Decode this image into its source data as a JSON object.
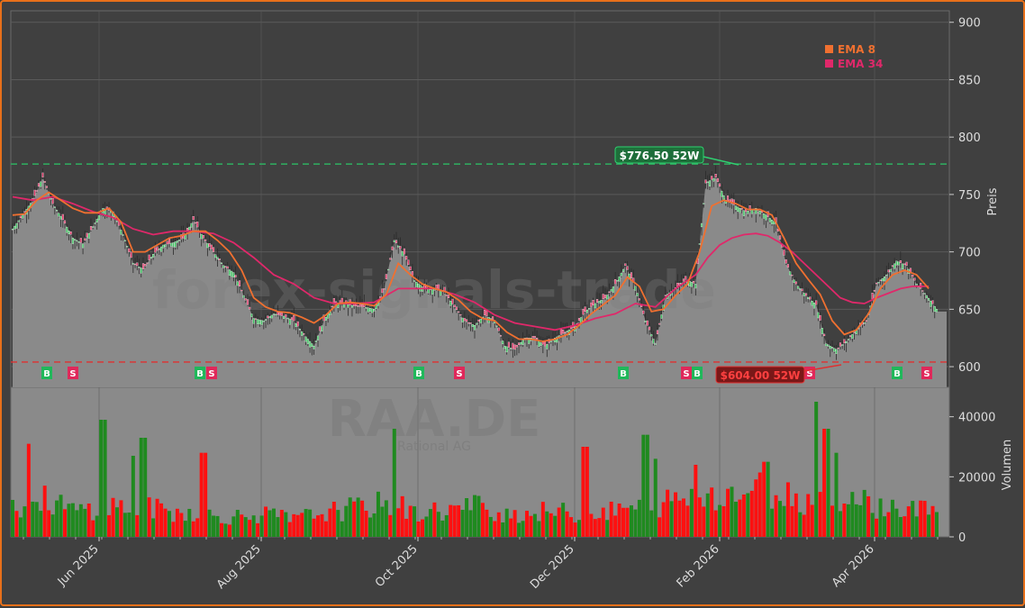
{
  "chart_data": {
    "type": "candlestick",
    "ticker_watermark": "RAA.DE",
    "company_watermark": "Rational AG",
    "site_watermark": "forex-signals-trade",
    "price_axis_label": "Preis",
    "volume_axis_label": "Volumen",
    "price_ticks": [
      600,
      650,
      700,
      750,
      800,
      850,
      900
    ],
    "price_ylim": [
      582,
      910
    ],
    "volume_ticks": [
      0,
      20000,
      40000
    ],
    "volume_ylim": [
      0,
      48000
    ],
    "x_ticks": [
      "Jun 2025",
      "Aug 2025",
      "Oct 2025",
      "Dec 2025",
      "Feb 2026",
      "Apr 2026"
    ],
    "high_52w": {
      "value": 776.5,
      "label": "$776.50 52W"
    },
    "low_52w": {
      "value": 604.0,
      "label": "$604.00 52W"
    },
    "legend": [
      {
        "name": "EMA 8",
        "color": "#f07030"
      },
      {
        "name": "EMA 34",
        "color": "#e0286a"
      }
    ],
    "signals": [
      "B",
      "S",
      "B",
      "S",
      "B",
      "S",
      "B",
      "S",
      "B",
      "S",
      "B",
      "S"
    ],
    "price_series": [
      [
        0,
        720
      ],
      [
        5,
        732
      ],
      [
        10,
        745
      ],
      [
        15,
        765
      ],
      [
        20,
        742
      ],
      [
        25,
        728
      ],
      [
        30,
        712
      ],
      [
        35,
        707
      ],
      [
        40,
        722
      ],
      [
        45,
        738
      ],
      [
        50,
        735
      ],
      [
        55,
        715
      ],
      [
        60,
        690
      ],
      [
        65,
        685
      ],
      [
        70,
        698
      ],
      [
        75,
        706
      ],
      [
        80,
        708
      ],
      [
        85,
        712
      ],
      [
        90,
        728
      ],
      [
        95,
        712
      ],
      [
        100,
        700
      ],
      [
        105,
        688
      ],
      [
        110,
        682
      ],
      [
        115,
        662
      ],
      [
        120,
        642
      ],
      [
        125,
        640
      ],
      [
        130,
        646
      ],
      [
        135,
        644
      ],
      [
        140,
        640
      ],
      [
        145,
        628
      ],
      [
        150,
        618
      ],
      [
        155,
        640
      ],
      [
        160,
        655
      ],
      [
        165,
        655
      ],
      [
        170,
        653
      ],
      [
        175,
        652
      ],
      [
        180,
        650
      ],
      [
        185,
        668
      ],
      [
        190,
        710
      ],
      [
        195,
        698
      ],
      [
        200,
        675
      ],
      [
        205,
        668
      ],
      [
        210,
        668
      ],
      [
        215,
        665
      ],
      [
        220,
        652
      ],
      [
        225,
        640
      ],
      [
        230,
        636
      ],
      [
        235,
        645
      ],
      [
        240,
        640
      ],
      [
        245,
        618
      ],
      [
        250,
        615
      ],
      [
        255,
        625
      ],
      [
        260,
        625
      ],
      [
        265,
        618
      ],
      [
        270,
        625
      ],
      [
        275,
        630
      ],
      [
        280,
        635
      ],
      [
        285,
        648
      ],
      [
        290,
        655
      ],
      [
        295,
        660
      ],
      [
        300,
        672
      ],
      [
        305,
        688
      ],
      [
        310,
        670
      ],
      [
        315,
        640
      ],
      [
        320,
        620
      ],
      [
        325,
        662
      ],
      [
        330,
        668
      ],
      [
        335,
        676
      ],
      [
        340,
        672
      ],
      [
        345,
        760
      ],
      [
        350,
        765
      ],
      [
        355,
        745
      ],
      [
        360,
        740
      ],
      [
        365,
        735
      ],
      [
        370,
        738
      ],
      [
        375,
        732
      ],
      [
        380,
        725
      ],
      [
        385,
        690
      ],
      [
        390,
        672
      ],
      [
        395,
        662
      ],
      [
        400,
        654
      ],
      [
        405,
        620
      ],
      [
        410,
        615
      ],
      [
        415,
        622
      ],
      [
        420,
        632
      ],
      [
        425,
        640
      ],
      [
        430,
        672
      ],
      [
        435,
        680
      ],
      [
        440,
        692
      ],
      [
        445,
        688
      ],
      [
        450,
        672
      ],
      [
        455,
        662
      ],
      [
        460,
        650
      ]
    ],
    "ema8": [
      [
        0,
        732
      ],
      [
        6,
        733
      ],
      [
        12,
        745
      ],
      [
        18,
        752
      ],
      [
        24,
        745
      ],
      [
        30,
        738
      ],
      [
        36,
        734
      ],
      [
        42,
        734
      ],
      [
        48,
        738
      ],
      [
        54,
        726
      ],
      [
        60,
        700
      ],
      [
        66,
        700
      ],
      [
        72,
        706
      ],
      [
        78,
        712
      ],
      [
        84,
        714
      ],
      [
        90,
        718
      ],
      [
        96,
        718
      ],
      [
        102,
        710
      ],
      [
        108,
        700
      ],
      [
        114,
        684
      ],
      [
        120,
        660
      ],
      [
        126,
        652
      ],
      [
        132,
        648
      ],
      [
        138,
        647
      ],
      [
        144,
        643
      ],
      [
        150,
        638
      ],
      [
        156,
        645
      ],
      [
        162,
        655
      ],
      [
        168,
        656
      ],
      [
        174,
        655
      ],
      [
        180,
        653
      ],
      [
        186,
        663
      ],
      [
        192,
        690
      ],
      [
        198,
        680
      ],
      [
        204,
        672
      ],
      [
        210,
        668
      ],
      [
        216,
        665
      ],
      [
        222,
        658
      ],
      [
        228,
        648
      ],
      [
        234,
        642
      ],
      [
        240,
        640
      ],
      [
        246,
        630
      ],
      [
        252,
        624
      ],
      [
        258,
        624
      ],
      [
        264,
        622
      ],
      [
        270,
        624
      ],
      [
        276,
        628
      ],
      [
        282,
        636
      ],
      [
        288,
        646
      ],
      [
        294,
        654
      ],
      [
        300,
        662
      ],
      [
        306,
        678
      ],
      [
        312,
        670
      ],
      [
        318,
        648
      ],
      [
        324,
        650
      ],
      [
        330,
        662
      ],
      [
        336,
        672
      ],
      [
        342,
        700
      ],
      [
        348,
        740
      ],
      [
        354,
        745
      ],
      [
        360,
        742
      ],
      [
        366,
        737
      ],
      [
        372,
        737
      ],
      [
        378,
        732
      ],
      [
        384,
        712
      ],
      [
        390,
        690
      ],
      [
        396,
        676
      ],
      [
        402,
        663
      ],
      [
        408,
        640
      ],
      [
        414,
        628
      ],
      [
        420,
        632
      ],
      [
        426,
        646
      ],
      [
        432,
        668
      ],
      [
        438,
        680
      ],
      [
        444,
        684
      ],
      [
        450,
        680
      ],
      [
        456,
        668
      ]
    ],
    "ema34": [
      [
        0,
        748
      ],
      [
        10,
        745
      ],
      [
        20,
        748
      ],
      [
        30,
        742
      ],
      [
        40,
        735
      ],
      [
        50,
        730
      ],
      [
        60,
        720
      ],
      [
        70,
        715
      ],
      [
        80,
        718
      ],
      [
        90,
        718
      ],
      [
        100,
        716
      ],
      [
        110,
        708
      ],
      [
        120,
        695
      ],
      [
        130,
        680
      ],
      [
        140,
        672
      ],
      [
        150,
        660
      ],
      [
        160,
        655
      ],
      [
        170,
        655
      ],
      [
        180,
        656
      ],
      [
        186,
        662
      ],
      [
        192,
        668
      ],
      [
        200,
        668
      ],
      [
        210,
        668
      ],
      [
        220,
        663
      ],
      [
        230,
        656
      ],
      [
        240,
        645
      ],
      [
        250,
        638
      ],
      [
        260,
        635
      ],
      [
        270,
        632
      ],
      [
        280,
        636
      ],
      [
        290,
        642
      ],
      [
        300,
        646
      ],
      [
        310,
        655
      ],
      [
        320,
        652
      ],
      [
        330,
        668
      ],
      [
        340,
        680
      ],
      [
        346,
        695
      ],
      [
        352,
        706
      ],
      [
        358,
        712
      ],
      [
        364,
        715
      ],
      [
        370,
        716
      ],
      [
        376,
        714
      ],
      [
        382,
        708
      ],
      [
        388,
        700
      ],
      [
        394,
        690
      ],
      [
        400,
        680
      ],
      [
        406,
        670
      ],
      [
        412,
        660
      ],
      [
        418,
        656
      ],
      [
        424,
        655
      ],
      [
        430,
        660
      ],
      [
        436,
        664
      ],
      [
        442,
        668
      ],
      [
        448,
        670
      ],
      [
        456,
        670
      ]
    ],
    "volume_series": [
      [
        0,
        10500
      ],
      [
        8,
        11000
      ],
      [
        15,
        13000
      ],
      [
        22,
        12000
      ],
      [
        30,
        9000
      ],
      [
        40,
        10000
      ],
      [
        50,
        11000
      ],
      [
        60,
        9500
      ],
      [
        70,
        10000
      ],
      [
        80,
        8500
      ],
      [
        90,
        9000
      ],
      [
        100,
        7500
      ],
      [
        110,
        7000
      ],
      [
        120,
        8000
      ],
      [
        130,
        7500
      ],
      [
        140,
        6000
      ],
      [
        150,
        8000
      ],
      [
        160,
        9000
      ],
      [
        170,
        10000
      ],
      [
        180,
        11000
      ],
      [
        190,
        12000
      ],
      [
        200,
        8000
      ],
      [
        210,
        9000
      ],
      [
        220,
        9500
      ],
      [
        230,
        11000
      ],
      [
        240,
        9000
      ],
      [
        250,
        8000
      ],
      [
        260,
        8500
      ],
      [
        270,
        9000
      ],
      [
        280,
        8000
      ],
      [
        290,
        8500
      ],
      [
        300,
        9000
      ],
      [
        310,
        10500
      ],
      [
        320,
        11000
      ],
      [
        330,
        13000
      ],
      [
        340,
        14000
      ],
      [
        350,
        16000
      ],
      [
        360,
        15000
      ],
      [
        370,
        17000
      ],
      [
        380,
        16000
      ],
      [
        390,
        14000
      ],
      [
        400,
        12000
      ],
      [
        410,
        15000
      ],
      [
        420,
        13000
      ],
      [
        430,
        11000
      ],
      [
        440,
        10000
      ],
      [
        450,
        9500
      ],
      [
        458,
        10500
      ]
    ],
    "volume_spikes": [
      [
        8,
        31000
      ],
      [
        45,
        39000
      ],
      [
        60,
        27000
      ],
      [
        65,
        33000
      ],
      [
        95,
        28000
      ],
      [
        190,
        36000
      ],
      [
        285,
        30000
      ],
      [
        315,
        34000
      ],
      [
        320,
        26000
      ],
      [
        340,
        24000
      ],
      [
        375,
        25000
      ],
      [
        400,
        45000
      ],
      [
        405,
        36000
      ],
      [
        410,
        28000
      ]
    ]
  }
}
